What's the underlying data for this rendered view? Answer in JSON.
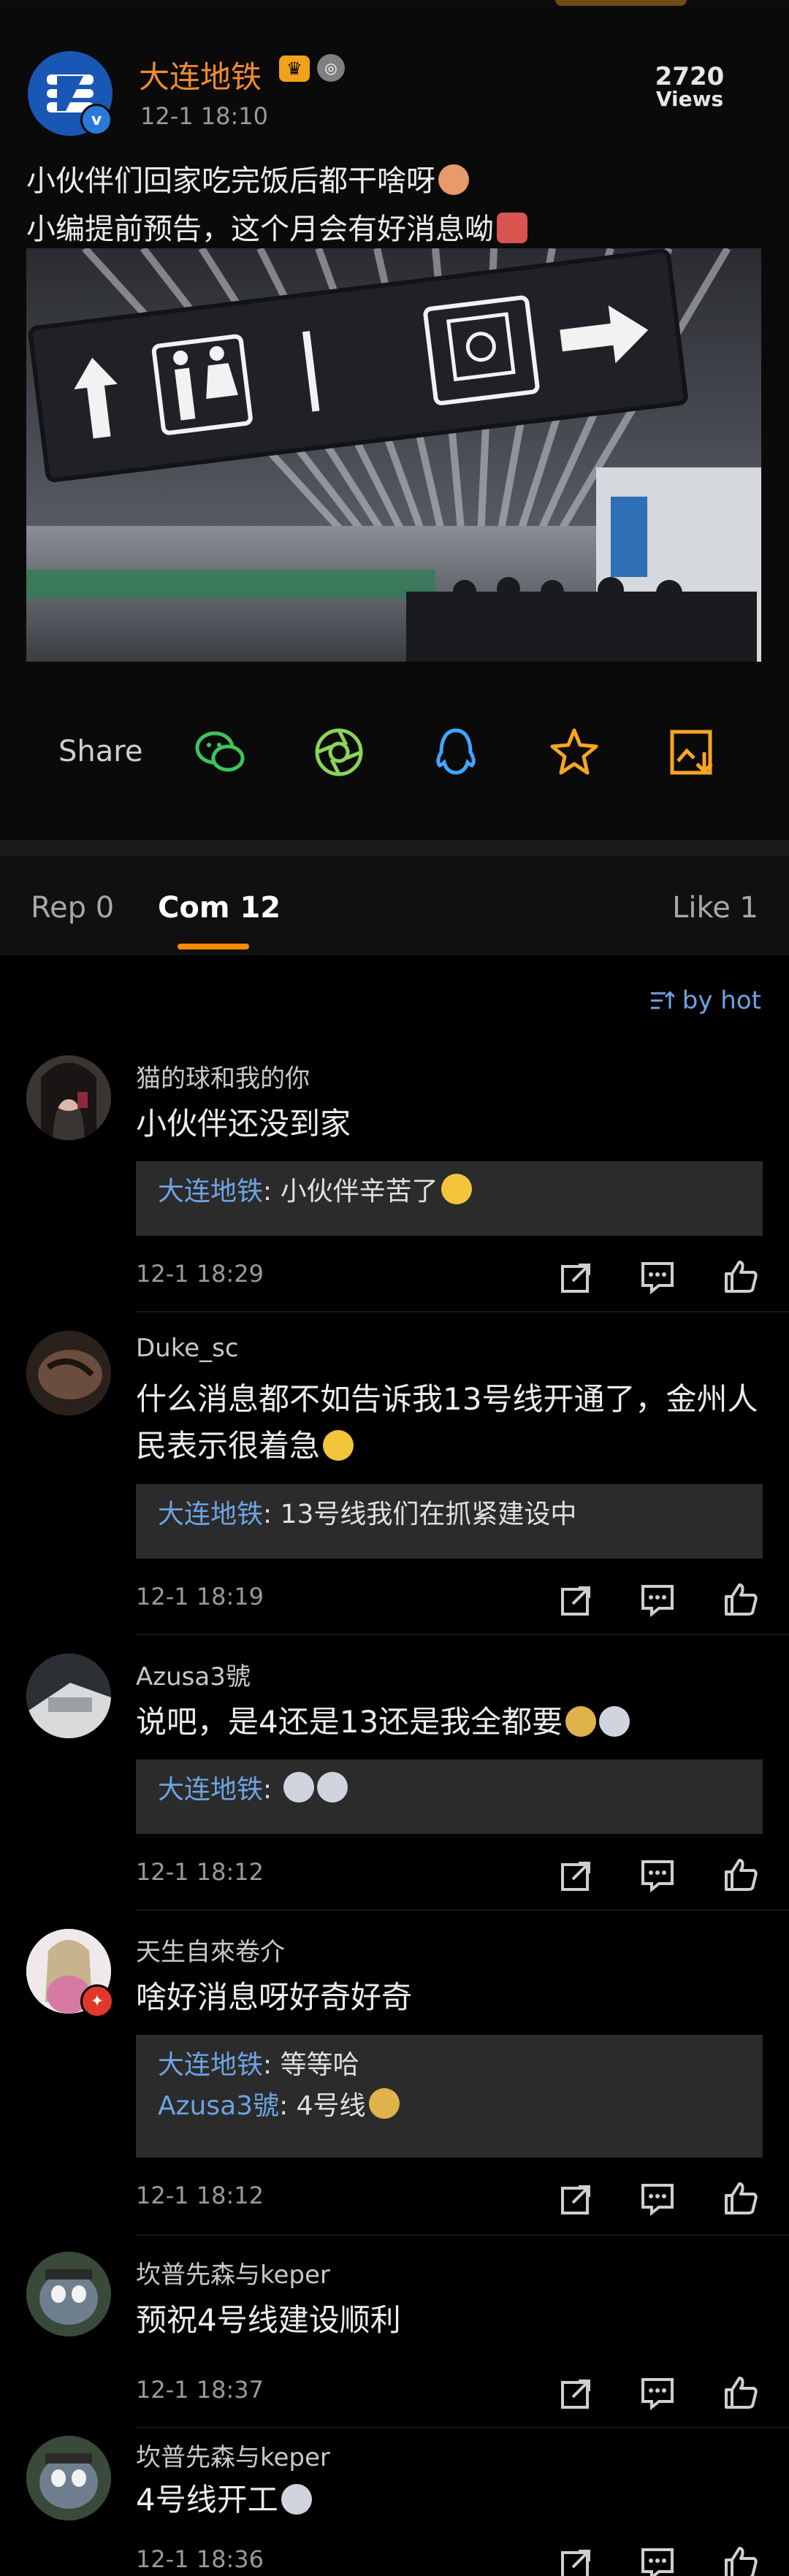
{
  "post": {
    "author": "大连地铁",
    "badge_vip": "♛",
    "badge_medal": "◎",
    "verified": "v",
    "time": "12-1 18:10",
    "views_number": "2720",
    "views_label": "Views",
    "text_line1": "小伙伴们回家吃完饭后都干啥呀",
    "text_line2": "小编提前预告，这个月会有好消息呦",
    "image_icons": [
      "arrow-up-icon",
      "restroom-icon",
      "accessible-elevator-icon",
      "arrow-right-icon"
    ]
  },
  "share": {
    "label": "Share",
    "icons": [
      "wechat-icon",
      "moments-icon",
      "qq-icon",
      "favorite-star-icon",
      "save-image-icon"
    ],
    "colors": {
      "wechat": "#3ec45b",
      "moments": "#8bd35a",
      "qq": "#3fa7ff",
      "star": "#f6a623",
      "save": "#f6a623"
    }
  },
  "tabs": {
    "reposts": "Rep 0",
    "comments": "Com 12",
    "likes": "Like 1"
  },
  "sort": {
    "icon": "sort-icon",
    "label": "by hot"
  },
  "comments": [
    {
      "name": "猫的球和我的你",
      "text": "小伙伴还没到家",
      "replies": [
        {
          "name": "大连地铁",
          "text": ": 小伙伴辛苦了"
        }
      ],
      "time": "12-1 18:29"
    },
    {
      "name": "Duke_sc",
      "text": "什么消息都不如告诉我13号线开通了，金州人民表示很着急",
      "replies": [
        {
          "name": "大连地铁",
          "text": ": 13号线我们在抓紧建设中"
        }
      ],
      "time": "12-1 18:19"
    },
    {
      "name": "Azusa3號",
      "text": "说吧，是4还是13还是我全都要",
      "replies": [
        {
          "name": "大连地铁",
          "text": ": "
        }
      ],
      "time": "12-1 18:12"
    },
    {
      "name": "天生自來卷介",
      "text": "啥好消息呀好奇好奇",
      "replies": [
        {
          "name": "大连地铁",
          "text": ": 等等哈"
        },
        {
          "name": "Azusa3號",
          "text": ": 4号线"
        }
      ],
      "time": "12-1 18:12"
    },
    {
      "name": "坎普先森与keper",
      "text": "预祝4号线建设顺利",
      "replies": [],
      "time": "12-1 18:37"
    },
    {
      "name": "坎普先森与keper",
      "text": "4号线开工",
      "replies": [],
      "time": "12-1 18:36"
    }
  ],
  "comment_action_icons": [
    "forward-icon",
    "reply-icon",
    "like-thumb-icon"
  ]
}
